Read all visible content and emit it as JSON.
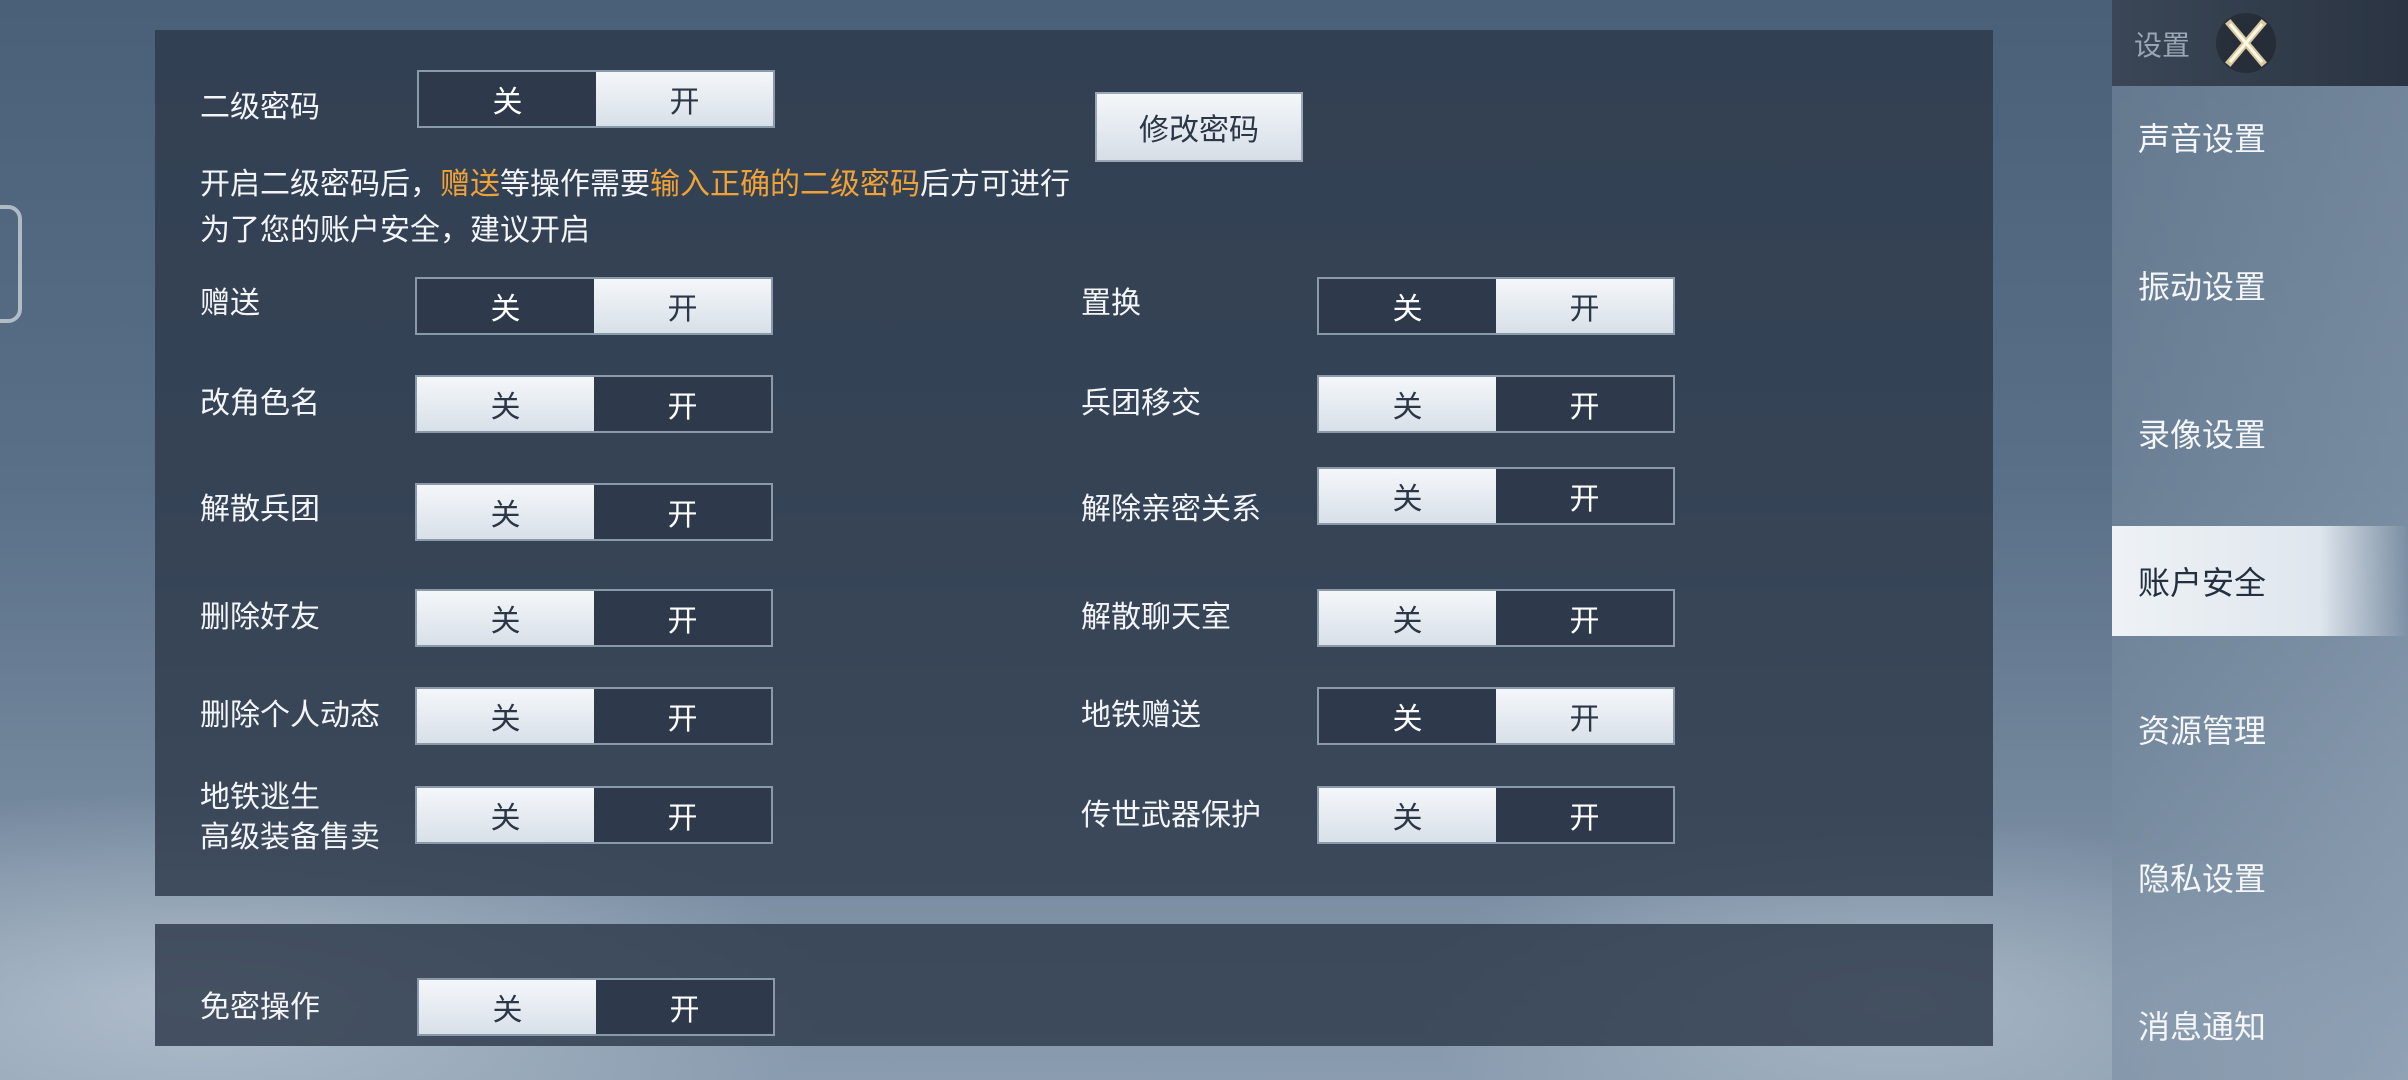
{
  "sidebar": {
    "title": "设置",
    "items": [
      {
        "label": "声音设置"
      },
      {
        "label": "振动设置"
      },
      {
        "label": "录像设置"
      },
      {
        "label": "账户安全",
        "active": true
      },
      {
        "label": "资源管理"
      },
      {
        "label": "隐私设置"
      },
      {
        "label": "消息通知"
      }
    ]
  },
  "password": {
    "label": "二级密码",
    "off": "关",
    "on": "开",
    "state": "on",
    "change_button": "修改密码"
  },
  "notice": {
    "line1_a": "开启二级密码后，",
    "line1_hl1": "赠送",
    "line1_b": "等操作需要",
    "line1_hl2": "输入正确的二级密码",
    "line1_c": "后方可进行",
    "line2": "为了您的账户安全，建议开启"
  },
  "settings": [
    {
      "label": "赠送",
      "state": "on"
    },
    {
      "label": "置换",
      "state": "on"
    },
    {
      "label": "改角色名",
      "state": "off"
    },
    {
      "label": "兵团移交",
      "state": "off"
    },
    {
      "label": "解散兵团",
      "state": "off"
    },
    {
      "label": "解除亲密关系",
      "state": "off"
    },
    {
      "label": "删除好友",
      "state": "off"
    },
    {
      "label": "解散聊天室",
      "state": "off"
    },
    {
      "label": "删除个人动态",
      "state": "off"
    },
    {
      "label": "地铁赠送",
      "state": "on"
    },
    {
      "label_line1": "地铁逃生",
      "label_line2": "高级装备售卖",
      "state": "off"
    },
    {
      "label": "传世武器保护",
      "state": "off"
    }
  ],
  "toggle_text": {
    "off": "关",
    "on": "开"
  },
  "free_password": {
    "label": "免密操作",
    "state": "off"
  },
  "colors": {
    "highlight": "#f0a236",
    "panel": "#2d394a",
    "toggle_on": "#e6ecf2"
  }
}
